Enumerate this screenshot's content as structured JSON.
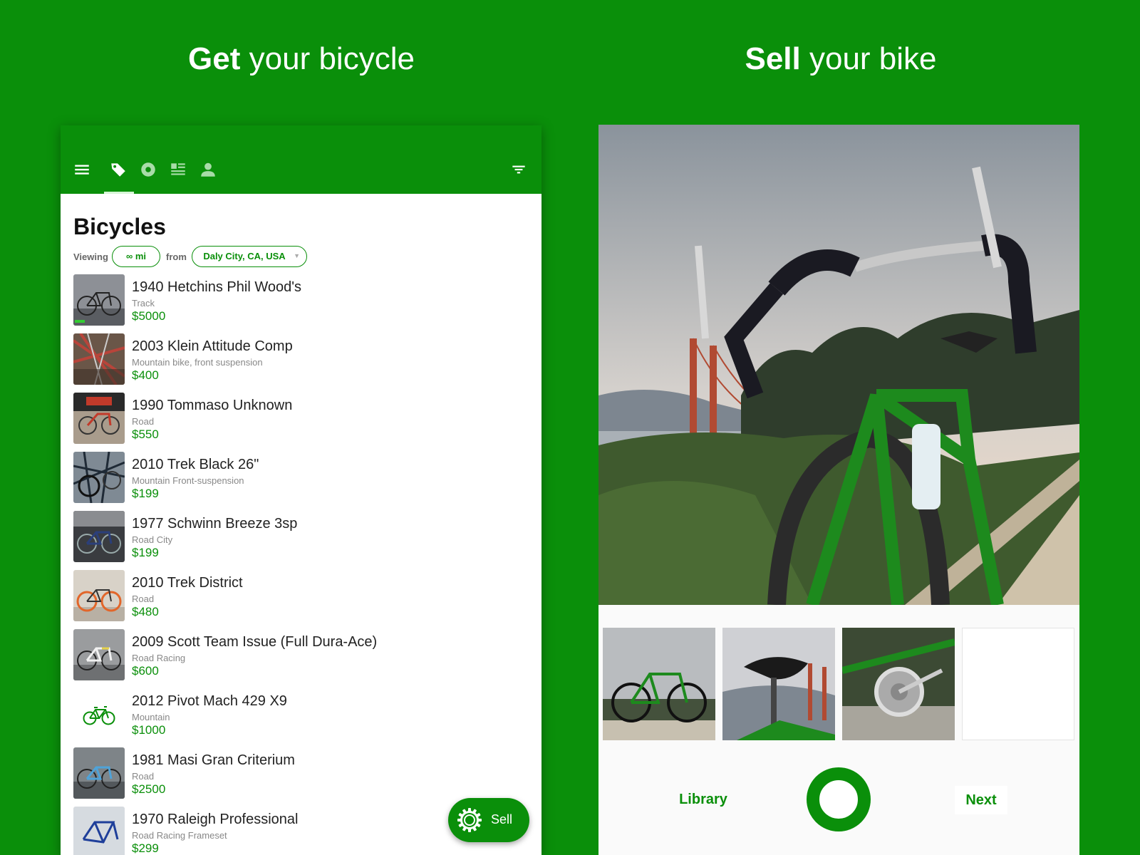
{
  "headlines": {
    "left_bold": "Get",
    "left_rest": " your bicycle",
    "right_bold": "Sell",
    "right_rest": " your bike"
  },
  "appbar": {
    "icons": [
      "menu-icon",
      "tag-icon",
      "wheel-icon",
      "news-icon",
      "person-icon",
      "filter-icon"
    ],
    "active_tab": "tag-icon"
  },
  "browse": {
    "title": "Bicycles",
    "viewing_label": "Viewing",
    "distance": "∞ mi",
    "from_label": "from",
    "location": "Daly City, CA, USA",
    "listings": [
      {
        "title": "1940 Hetchins Phil Wood's",
        "subtitle": "Track",
        "price": "$5000"
      },
      {
        "title": "2003 Klein Attitude Comp",
        "subtitle": "Mountain bike, front suspension",
        "price": "$400"
      },
      {
        "title": "1990 Tommaso Unknown",
        "subtitle": "Road",
        "price": "$550"
      },
      {
        "title": "2010 Trek Black 26\"",
        "subtitle": "Mountain Front-suspension",
        "price": "$199"
      },
      {
        "title": "1977 Schwinn Breeze 3sp",
        "subtitle": "Road City",
        "price": "$199"
      },
      {
        "title": "2010 Trek District",
        "subtitle": "Road",
        "price": "$480"
      },
      {
        "title": "2009 Scott Team Issue (Full Dura-Ace)",
        "subtitle": "Road Racing",
        "price": "$600"
      },
      {
        "title": "2012 Pivot Mach 429 X9",
        "subtitle": "Mountain",
        "price": "$1000"
      },
      {
        "title": "1981 Masi Gran Criterium",
        "subtitle": "Road",
        "price": "$2500"
      },
      {
        "title": "1970 Raleigh Professional",
        "subtitle": "Road Racing Frameset",
        "price": "$299"
      }
    ],
    "sell_label": "Sell"
  },
  "sell": {
    "library_label": "Library",
    "next_label": "Next"
  },
  "colors": {
    "brand_green": "#0a8f0a",
    "price_green": "#0a8f0a"
  }
}
